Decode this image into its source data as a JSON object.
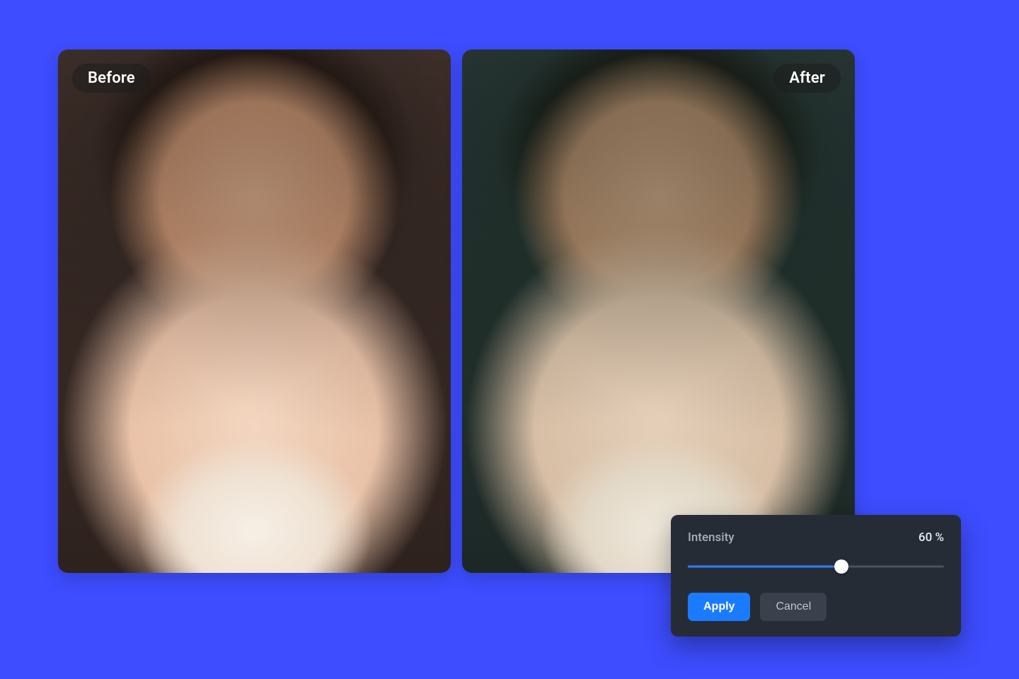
{
  "compare": {
    "before_label": "Before",
    "after_label": "After"
  },
  "controls": {
    "slider_label": "Intensity",
    "slider_value_display": "60 %",
    "slider_percent": 60,
    "apply_label": "Apply",
    "cancel_label": "Cancel"
  },
  "colors": {
    "background": "#3D4DFF",
    "accent": "#1B7BFF",
    "panel": "#262C36"
  }
}
